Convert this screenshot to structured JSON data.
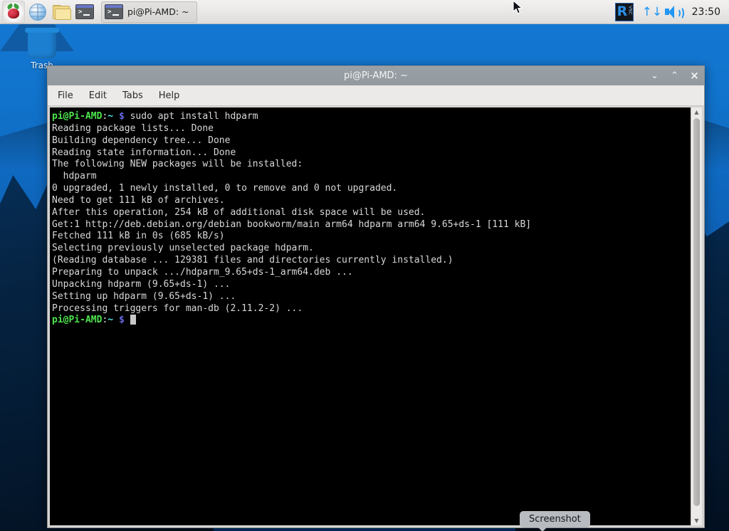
{
  "panel": {
    "launchers": [
      {
        "name": "raspberry-menu",
        "icon": "raspberry-icon",
        "label": "Menu"
      },
      {
        "name": "web-browser",
        "icon": "globe-icon",
        "label": "Web Browser"
      },
      {
        "name": "file-manager",
        "icon": "folder-icon",
        "label": "File Manager"
      },
      {
        "name": "terminal",
        "icon": "terminal-icon",
        "label": "Terminal"
      }
    ],
    "task_buttons": [
      {
        "icon": "terminal-icon",
        "label": "pi@Pi-AMD: ~"
      }
    ],
    "tray": {
      "vnc_letter": "R",
      "vnc_text": "VNC",
      "network_icon": "network-up-down-icon",
      "network_glyph": "↑↓",
      "volume_icon": "volume-icon",
      "clock": "23:50"
    }
  },
  "desktop": {
    "icons": [
      {
        "name": "trash",
        "label": "Trash"
      }
    ]
  },
  "window": {
    "title": "pi@Pi-AMD: ~",
    "controls": {
      "minimize": "⌄",
      "maximize": "⌃",
      "close": "×"
    },
    "menu": [
      "File",
      "Edit",
      "Tabs",
      "Help"
    ],
    "scrollbar": {
      "up": "▲",
      "down": "▼"
    }
  },
  "terminal": {
    "prompt": {
      "user_host": "pi@Pi-AMD",
      "colon": ":",
      "path": "~",
      "dollar": "$"
    },
    "command": " sudo apt install hdparm",
    "output_lines": [
      "Reading package lists... Done",
      "Building dependency tree... Done",
      "Reading state information... Done",
      "The following NEW packages will be installed:",
      "  hdparm",
      "0 upgraded, 1 newly installed, 0 to remove and 0 not upgraded.",
      "Need to get 111 kB of archives.",
      "After this operation, 254 kB of additional disk space will be used.",
      "Get:1 http://deb.debian.org/debian bookworm/main arm64 hdparm arm64 9.65+ds-1 [111 kB]",
      "Fetched 111 kB in 0s (685 kB/s)",
      "Selecting previously unselected package hdparm.",
      "(Reading database ... 129381 files and directories currently installed.)",
      "Preparing to unpack .../hdparm_9.65+ds-1_arm64.deb ...",
      "Unpacking hdparm (9.65+ds-1) ...",
      "Setting up hdparm (9.65+ds-1) ...",
      "Processing triggers for man-db (2.11.2-2) ..."
    ]
  },
  "tooltip": {
    "screenshot": "Screenshot"
  },
  "colors": {
    "desktop_blue": "#1173cc",
    "panel_bg": "#e9e8e7",
    "terminal_bg": "#000000",
    "prompt_green": "#4ee44e",
    "prompt_cyan": "#4ee8e8",
    "accent_blue": "#2196f3",
    "titlebar_gray": "#939a9f"
  }
}
